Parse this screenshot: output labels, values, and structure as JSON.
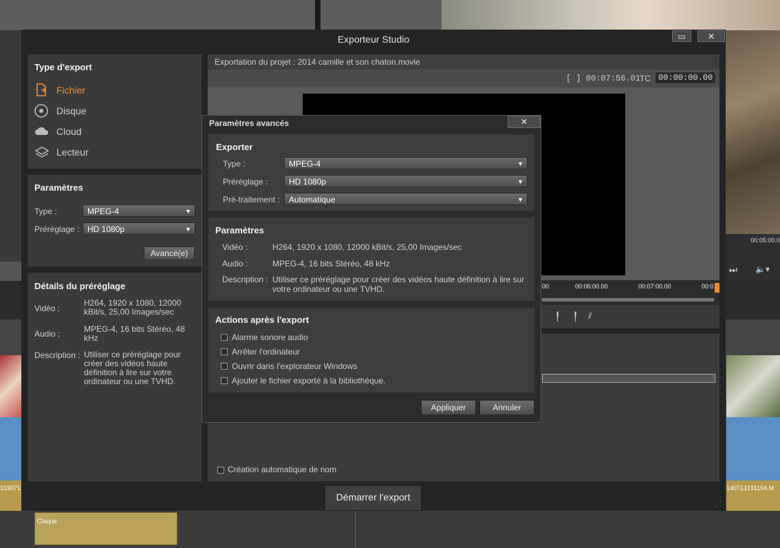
{
  "background": {
    "right_time": "00:05:00.0",
    "clip_label_left": "319071",
    "clip_label_right": "140713191104.M",
    "claque_label": "Claque"
  },
  "window": {
    "title": "Exporteur Studio",
    "maximize_icon": "maximize-icon",
    "close_icon": "close-icon"
  },
  "export_type": {
    "heading": "Type d'export",
    "items": [
      {
        "label": "Fichier",
        "icon": "file-export-icon"
      },
      {
        "label": "Disque",
        "icon": "disc-icon"
      },
      {
        "label": "Cloud",
        "icon": "cloud-icon"
      },
      {
        "label": "Lecteur",
        "icon": "device-icon"
      }
    ],
    "active_color": "#f28c28"
  },
  "params": {
    "heading": "Paramètres",
    "type_label": "Type :",
    "type_value": "MPEG-4",
    "preset_label": "Préréglage :",
    "preset_value": "HD 1080p",
    "advanced_button": "Avancé(e)"
  },
  "preset_details": {
    "heading": "Détails du préréglage",
    "video_label": "Vidéo :",
    "video_value": "H264, 1920 x 1080, 12000 kBit/s, 25,00 Images/sec",
    "audio_label": "Audio :",
    "audio_value": "MPEG-4, 16 bits Stéréo, 48 kHz",
    "desc_label": "Description :",
    "desc_value": "Utiliser ce préréglage pour créer des vidéos haute définition à lire sur votre ordinateur ou une TVHD."
  },
  "preview": {
    "project_text": "Exportation du projet : 2014 camille et son chaton.movie",
    "duration": "[ ] 00:07:56.01",
    "tc_label": "TC",
    "tc_value": "00:00:00.00",
    "ruler": [
      "00",
      "00:06:00.00",
      "00:07:00.00",
      "00:0"
    ]
  },
  "auto_name": {
    "label": "Création automatique de nom"
  },
  "start_export": "Démarrer l'export",
  "dialog": {
    "title": "Paramètres avancés",
    "export_section": {
      "heading": "Exporter",
      "type_label": "Type :",
      "type_value": "MPEG-4",
      "preset_label": "Préréglage :",
      "preset_value": "HD 1080p",
      "pre_label": "Pré-traitement :",
      "pre_value": "Automatique"
    },
    "params_section": {
      "heading": "Paramètres",
      "video_label": "Vidéo :",
      "video_value": "H264, 1920 x 1080, 12000 kBit/s, 25,00 Images/sec",
      "audio_label": "Audio :",
      "audio_value": "MPEG-4, 16 bits Stéréo, 48 kHz",
      "desc_label": "Description :",
      "desc_value": "Utiliser ce préréglage pour créer des vidéos haute définition à lire sur votre ordinateur ou une TVHD."
    },
    "actions_section": {
      "heading": "Actions après l'export",
      "options": [
        "Alarme sonore audio",
        "Arrêter l'ordinateur",
        "Ouvrir dans l'explorateur Windows",
        "Ajouter le fichier exporté à la bibliothèque."
      ]
    },
    "apply_button": "Appliquer",
    "cancel_button": "Annuler"
  }
}
